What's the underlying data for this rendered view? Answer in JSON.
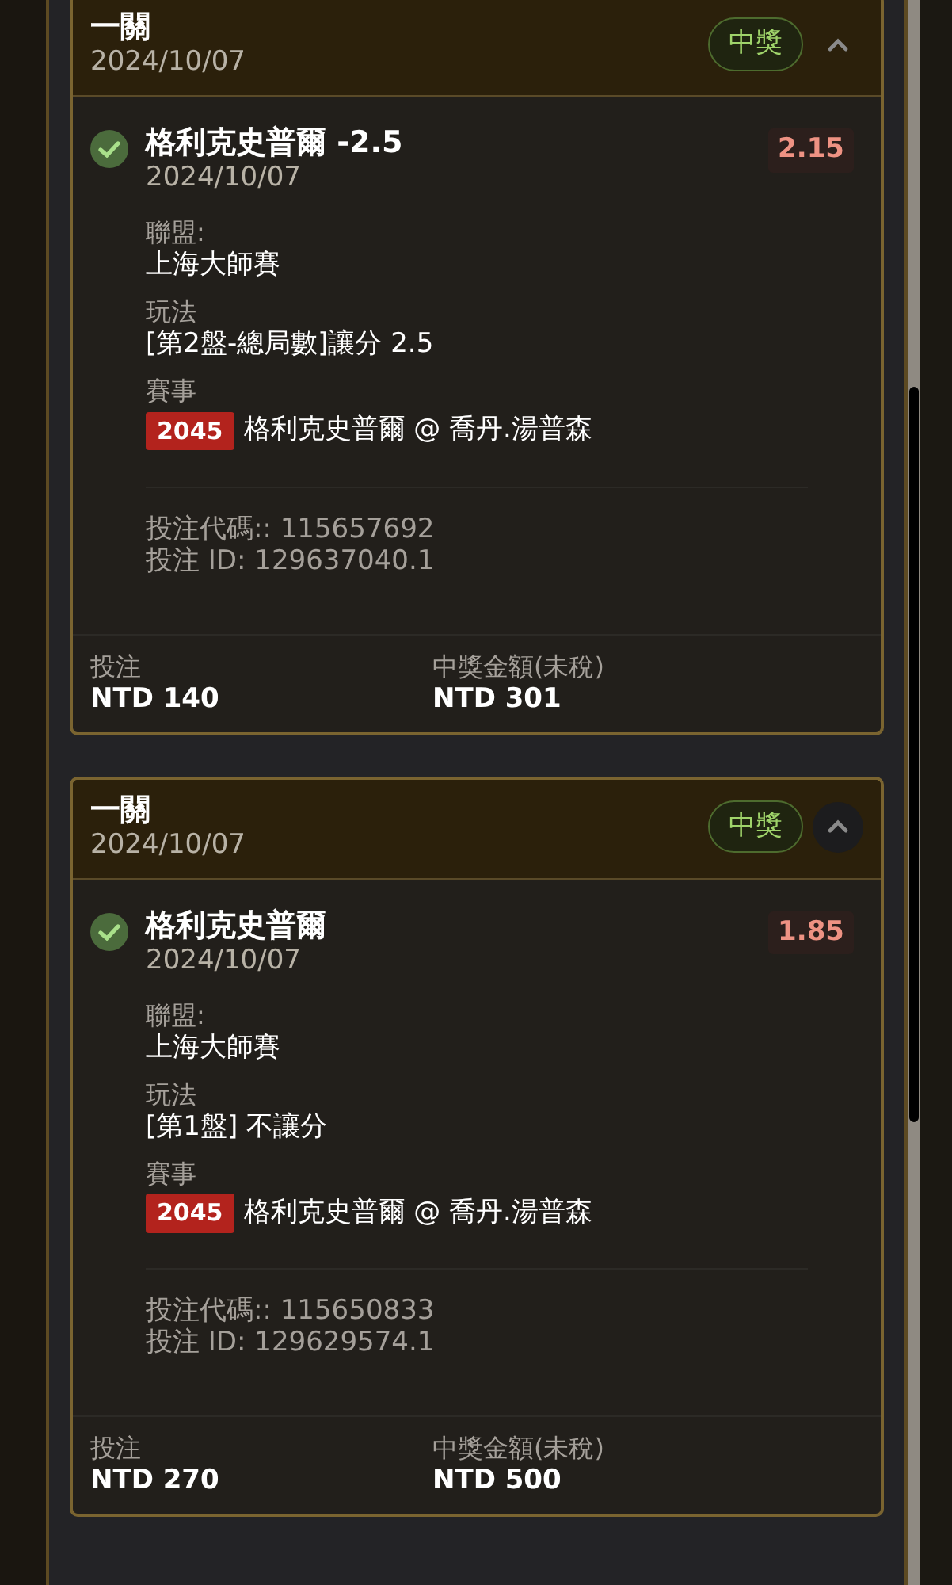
{
  "bets": [
    {
      "type": "一關",
      "date": "2024/10/07",
      "status": "中獎",
      "expanded": true,
      "chevron_highlighted": false,
      "selection": {
        "won": true,
        "name": "格利克史普爾 -2.5",
        "date": "2024/10/07",
        "odds": "2.15"
      },
      "details": [
        {
          "label": "聯盟:",
          "value": "上海大師賽"
        },
        {
          "label": "玩法",
          "value": "[第2盤-總局數]讓分 2.5"
        }
      ],
      "event": {
        "label": "賽事",
        "code": "2045",
        "match": "格利克史普爾 @ 喬丹.湯普森"
      },
      "bet_code": "投注代碼:: 115657692",
      "bet_id": "投注 ID: 129637040.1",
      "stake": {
        "label": "投注",
        "value": "NTD 140"
      },
      "payout": {
        "label": "中獎金額(未稅)",
        "value": "NTD 301"
      }
    },
    {
      "type": "一關",
      "date": "2024/10/07",
      "status": "中獎",
      "expanded": true,
      "chevron_highlighted": true,
      "selection": {
        "won": true,
        "name": "格利克史普爾",
        "date": "2024/10/07",
        "odds": "1.85"
      },
      "details": [
        {
          "label": "聯盟:",
          "value": "上海大師賽"
        },
        {
          "label": "玩法",
          "value": "[第1盤] 不讓分"
        }
      ],
      "event": {
        "label": "賽事",
        "code": "2045",
        "match": "格利克史普爾 @ 喬丹.湯普森"
      },
      "bet_code": "投注代碼:: 115650833",
      "bet_id": "投注 ID: 129629574.1",
      "stake": {
        "label": "投注",
        "value": "NTD 270"
      },
      "payout": {
        "label": "中獎金額(未稅)",
        "value": "NTD 500"
      }
    }
  ]
}
